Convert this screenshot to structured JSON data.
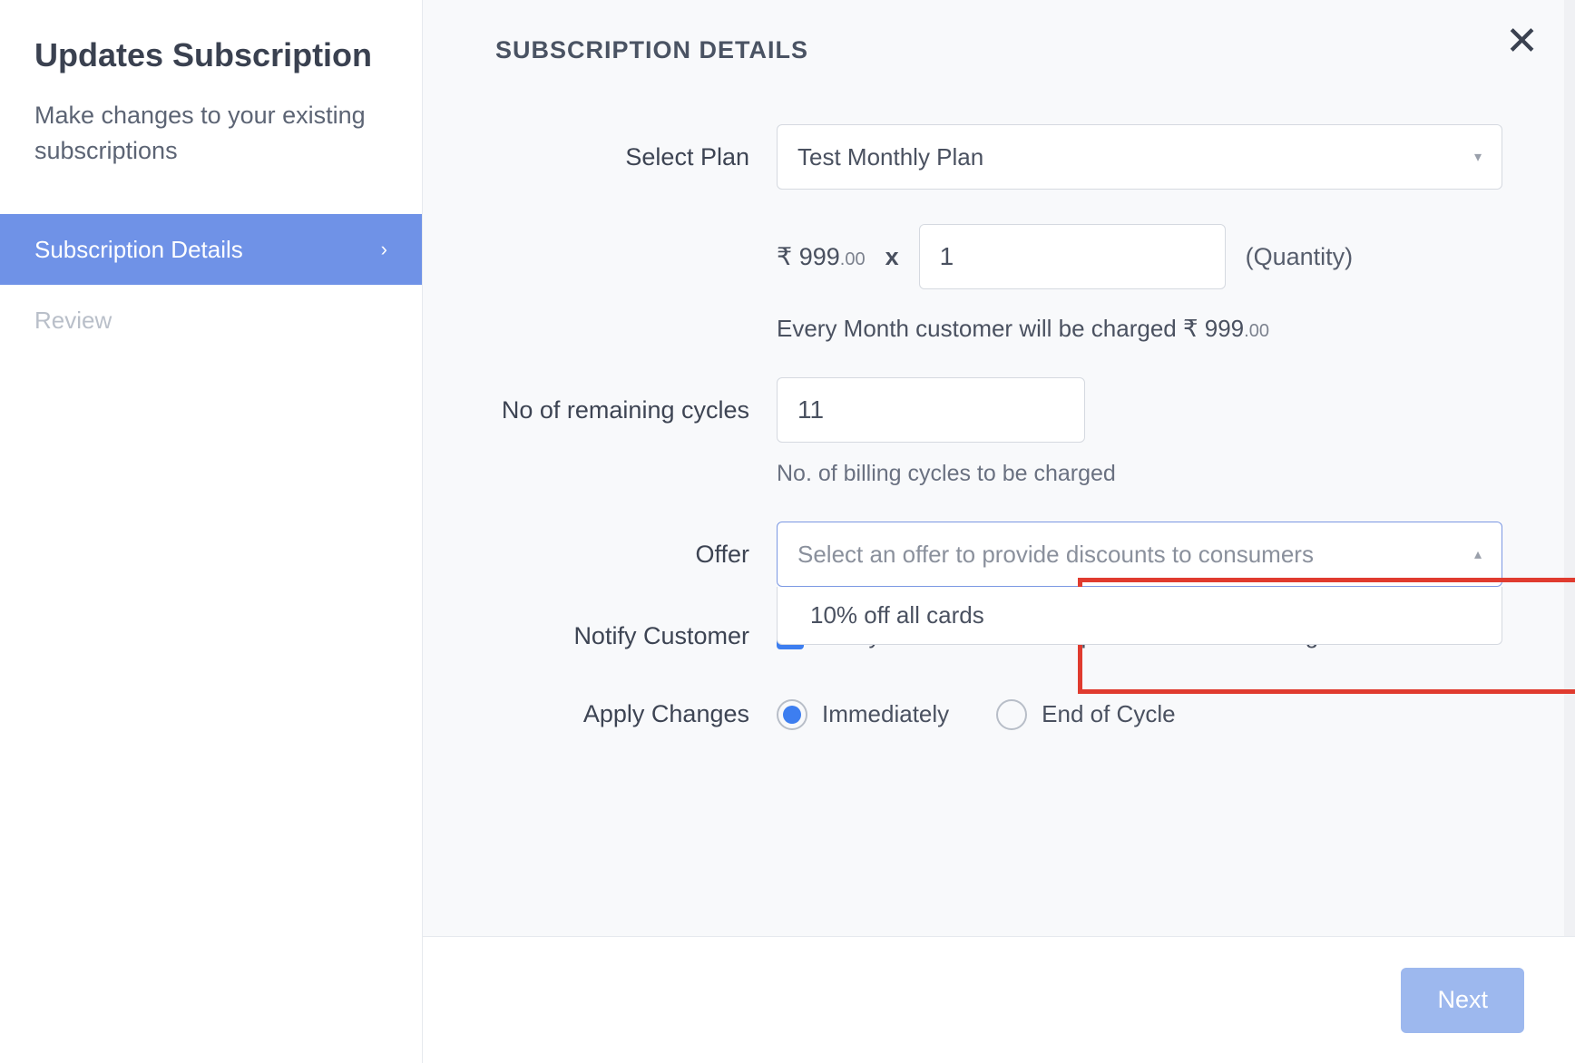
{
  "sidebar": {
    "title": "Updates Subscription",
    "subtitle": "Make changes to your existing subscriptions",
    "steps": [
      {
        "label": "Subscription Details",
        "active": true
      },
      {
        "label": "Review",
        "active": false
      }
    ]
  },
  "main": {
    "section_title": "SUBSCRIPTION DETAILS",
    "close_glyph": "✕",
    "plan": {
      "label": "Select Plan",
      "value": "Test Monthly Plan"
    },
    "price": {
      "currency": "₹",
      "amount_int": "999",
      "amount_dec": ".00",
      "multiply": "x",
      "quantity": "1",
      "quantity_label": "(Quantity)",
      "summary_prefix": "Every Month customer will be charged ",
      "summary_amount_int": "999",
      "summary_amount_dec": ".00"
    },
    "cycles": {
      "label": "No of remaining cycles",
      "value": "11",
      "help": "No. of billing cycles to be charged"
    },
    "offer": {
      "label": "Offer",
      "placeholder": "Select an offer to provide discounts to consumers",
      "options": [
        "10% off all cards"
      ]
    },
    "notify": {
      "label": "Notify Customer",
      "checkbox_label": "Notify customer for this update and future charges.",
      "checked": true
    },
    "apply": {
      "label": "Apply Changes",
      "options": [
        {
          "label": "Immediately",
          "selected": true
        },
        {
          "label": "End of Cycle",
          "selected": false
        }
      ]
    }
  },
  "footer": {
    "next": "Next"
  }
}
